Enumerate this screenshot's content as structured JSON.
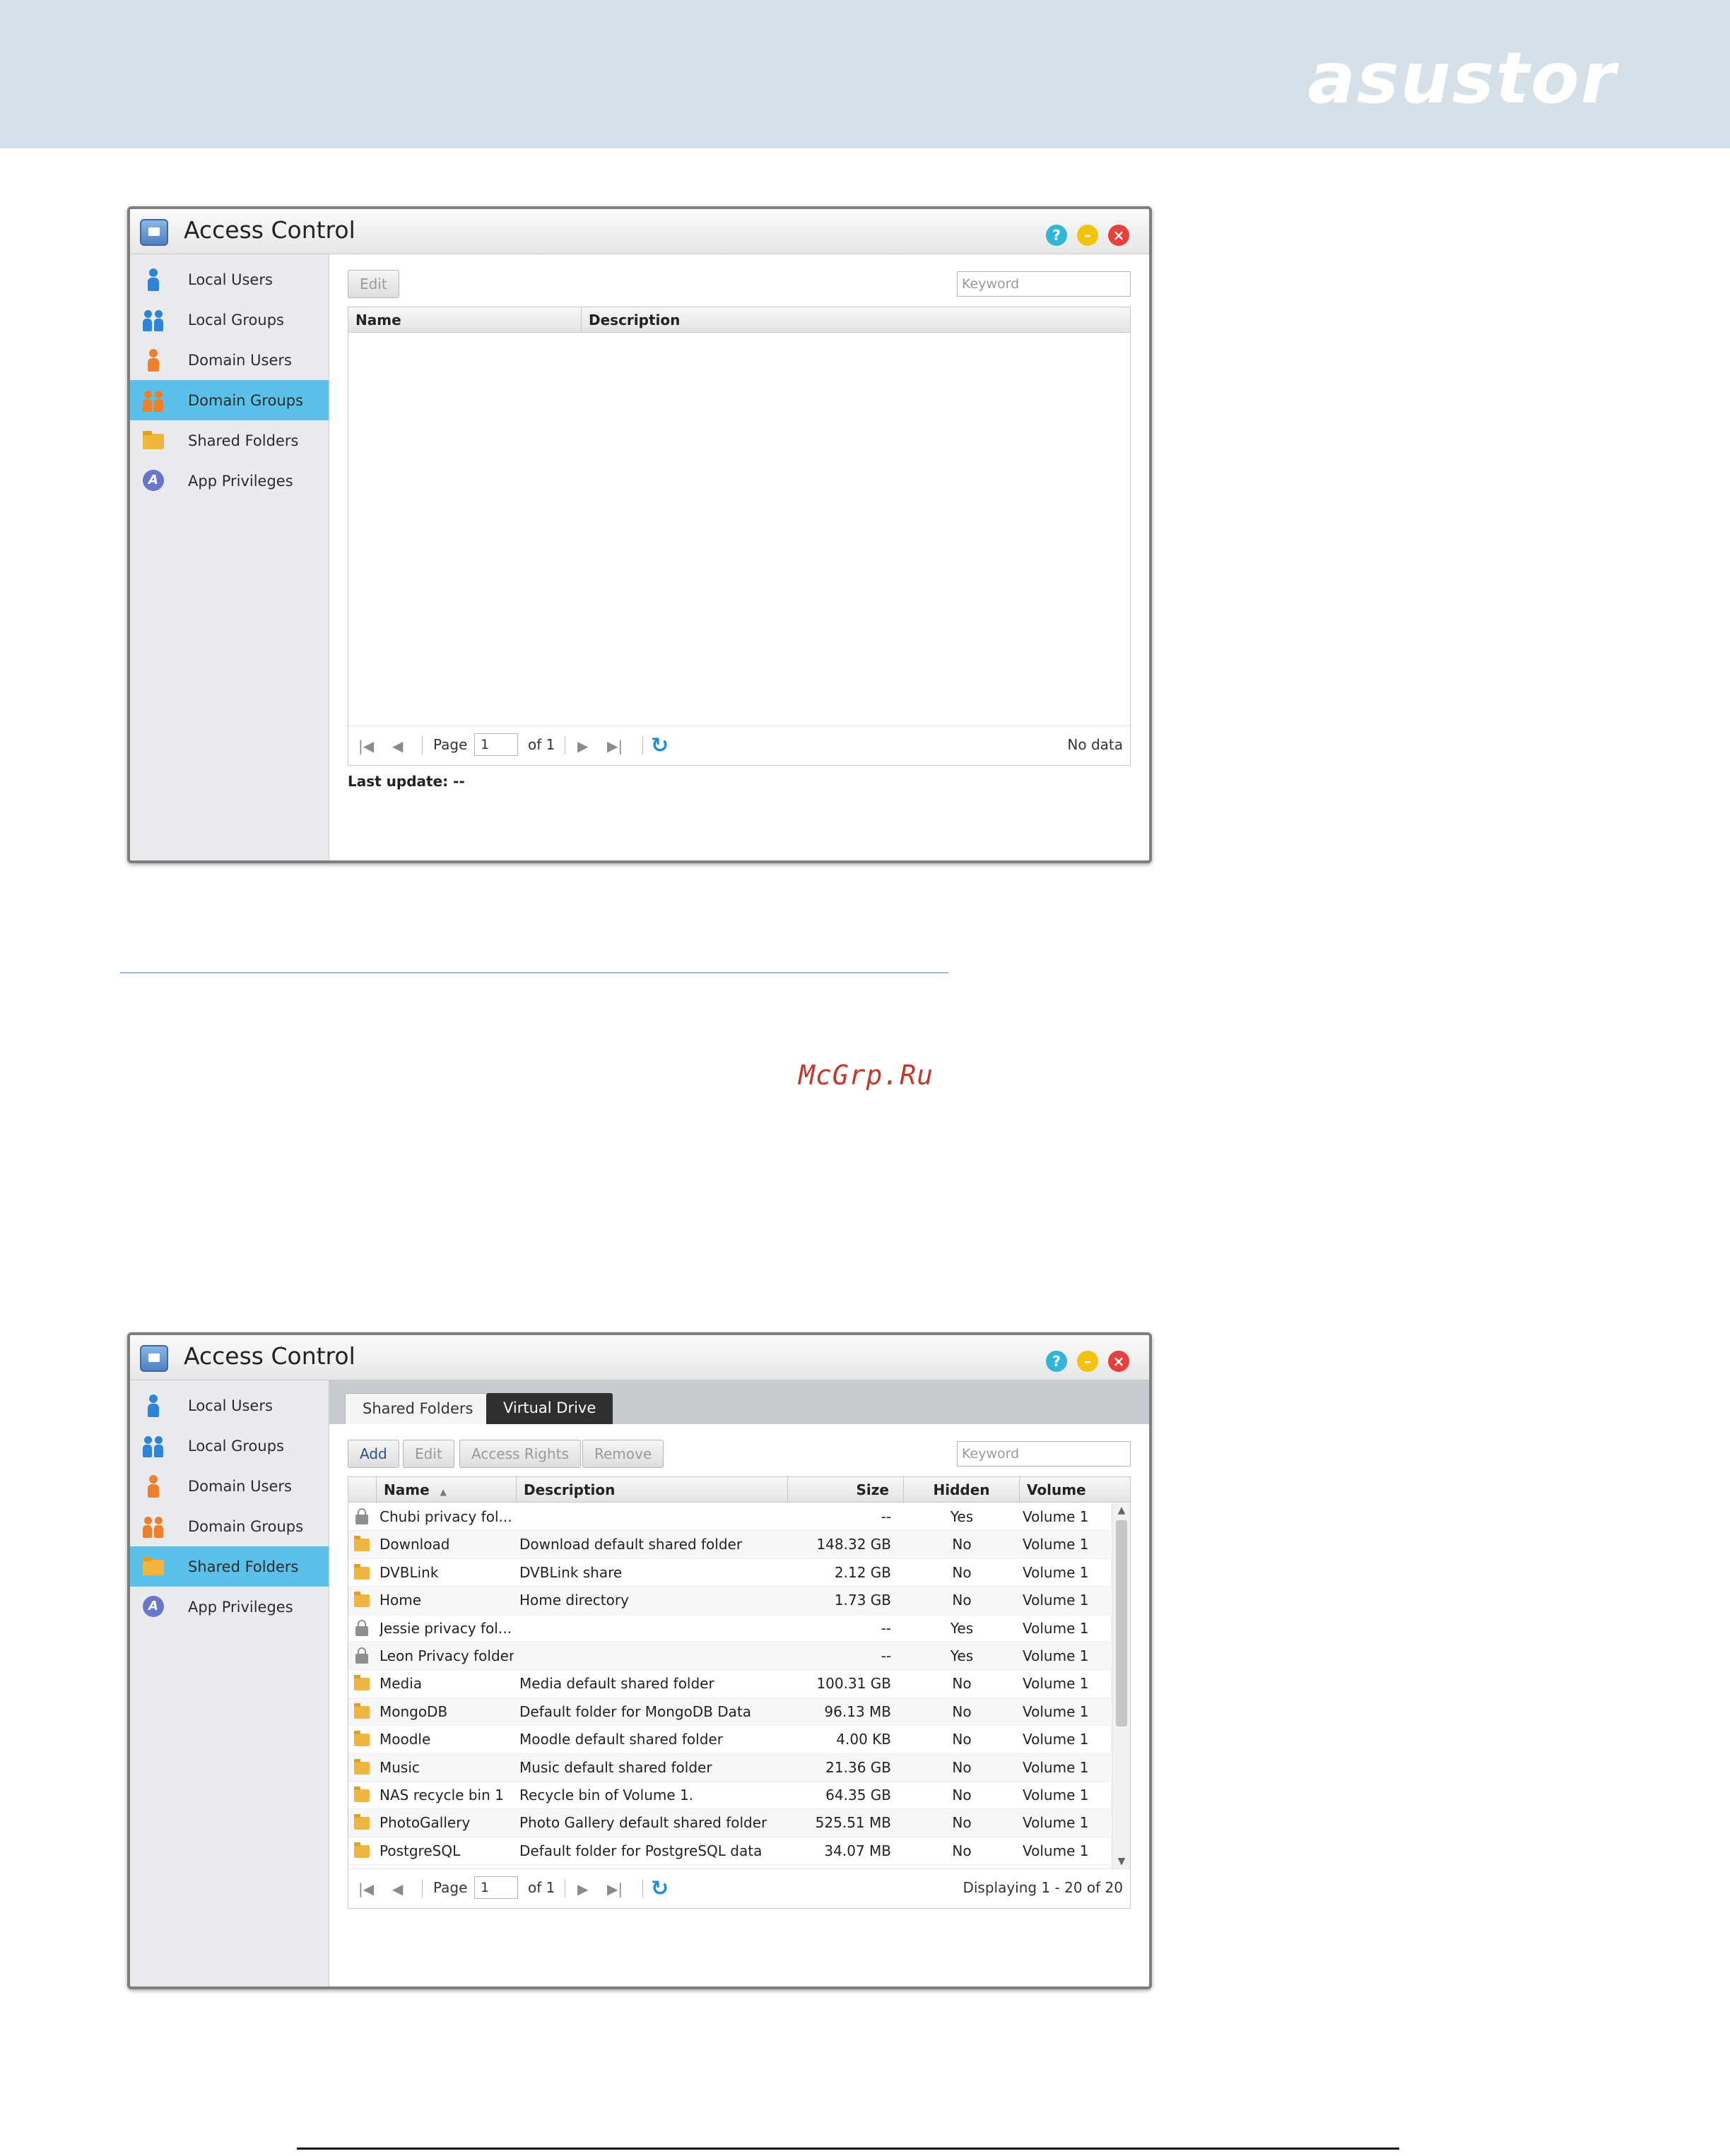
{
  "header": {
    "brand": "asustor"
  },
  "watermark": "McGrp.Ru",
  "window1": {
    "title": "Access Control",
    "sidebar": [
      "Local Users",
      "Local Groups",
      "Domain Users",
      "Domain Groups",
      "Shared Folders",
      "App Privileges"
    ],
    "active_item": "Domain Groups",
    "toolbar": {
      "edit": "Edit",
      "keyword_placeholder": "Keyword"
    },
    "columns": [
      "Name",
      "Description"
    ],
    "pager": {
      "page_label": "Page",
      "page": "1",
      "of_label": "of 1",
      "status": "No data"
    },
    "last_update_label": "Last update:",
    "last_update_value": "--"
  },
  "window2": {
    "title": "Access Control",
    "sidebar": [
      "Local Users",
      "Local Groups",
      "Domain Users",
      "Domain Groups",
      "Shared Folders",
      "App Privileges"
    ],
    "active_item": "Shared Folders",
    "tabs": [
      "Shared Folders",
      "Virtual Drive"
    ],
    "toolbar": {
      "add": "Add",
      "edit": "Edit",
      "access_rights": "Access Rights",
      "remove": "Remove",
      "keyword_placeholder": "Keyword"
    },
    "columns": [
      "Name",
      "Description",
      "Size",
      "Hidden",
      "Volume"
    ],
    "rows": [
      {
        "icon": "lock",
        "name": "Chubi privacy fol...",
        "description": "",
        "size": "--",
        "hidden": "Yes",
        "volume": "Volume 1"
      },
      {
        "icon": "folder",
        "name": "Download",
        "description": "Download default shared folder",
        "size": "148.32 GB",
        "hidden": "No",
        "volume": "Volume 1"
      },
      {
        "icon": "folder",
        "name": "DVBLink",
        "description": "DVBLink share",
        "size": "2.12 GB",
        "hidden": "No",
        "volume": "Volume 1"
      },
      {
        "icon": "folder",
        "name": "Home",
        "description": "Home directory",
        "size": "1.73 GB",
        "hidden": "No",
        "volume": "Volume 1"
      },
      {
        "icon": "lock",
        "name": "Jessie privacy fol...",
        "description": "",
        "size": "--",
        "hidden": "Yes",
        "volume": "Volume 1"
      },
      {
        "icon": "lock",
        "name": "Leon Privacy folder",
        "description": "",
        "size": "--",
        "hidden": "Yes",
        "volume": "Volume 1"
      },
      {
        "icon": "folder",
        "name": "Media",
        "description": "Media default shared folder",
        "size": "100.31 GB",
        "hidden": "No",
        "volume": "Volume 1"
      },
      {
        "icon": "folder",
        "name": "MongoDB",
        "description": "Default folder for MongoDB Data",
        "size": "96.13 MB",
        "hidden": "No",
        "volume": "Volume 1"
      },
      {
        "icon": "folder",
        "name": "Moodle",
        "description": "Moodle default shared folder",
        "size": "4.00 KB",
        "hidden": "No",
        "volume": "Volume 1"
      },
      {
        "icon": "folder",
        "name": "Music",
        "description": "Music default shared folder",
        "size": "21.36 GB",
        "hidden": "No",
        "volume": "Volume 1"
      },
      {
        "icon": "folder",
        "name": "NAS recycle bin 1",
        "description": "Recycle bin of Volume 1.",
        "size": "64.35 GB",
        "hidden": "No",
        "volume": "Volume 1"
      },
      {
        "icon": "folder",
        "name": "PhotoGallery",
        "description": "Photo Gallery default shared folder",
        "size": "525.51 MB",
        "hidden": "No",
        "volume": "Volume 1"
      },
      {
        "icon": "folder",
        "name": "PostgreSQL",
        "description": "Default folder for PostgreSQL data",
        "size": "34.07 MB",
        "hidden": "No",
        "volume": "Volume 1"
      }
    ],
    "pager": {
      "page_label": "Page",
      "page": "1",
      "of_label": "of 1",
      "status": "Displaying 1 - 20 of 20"
    }
  }
}
